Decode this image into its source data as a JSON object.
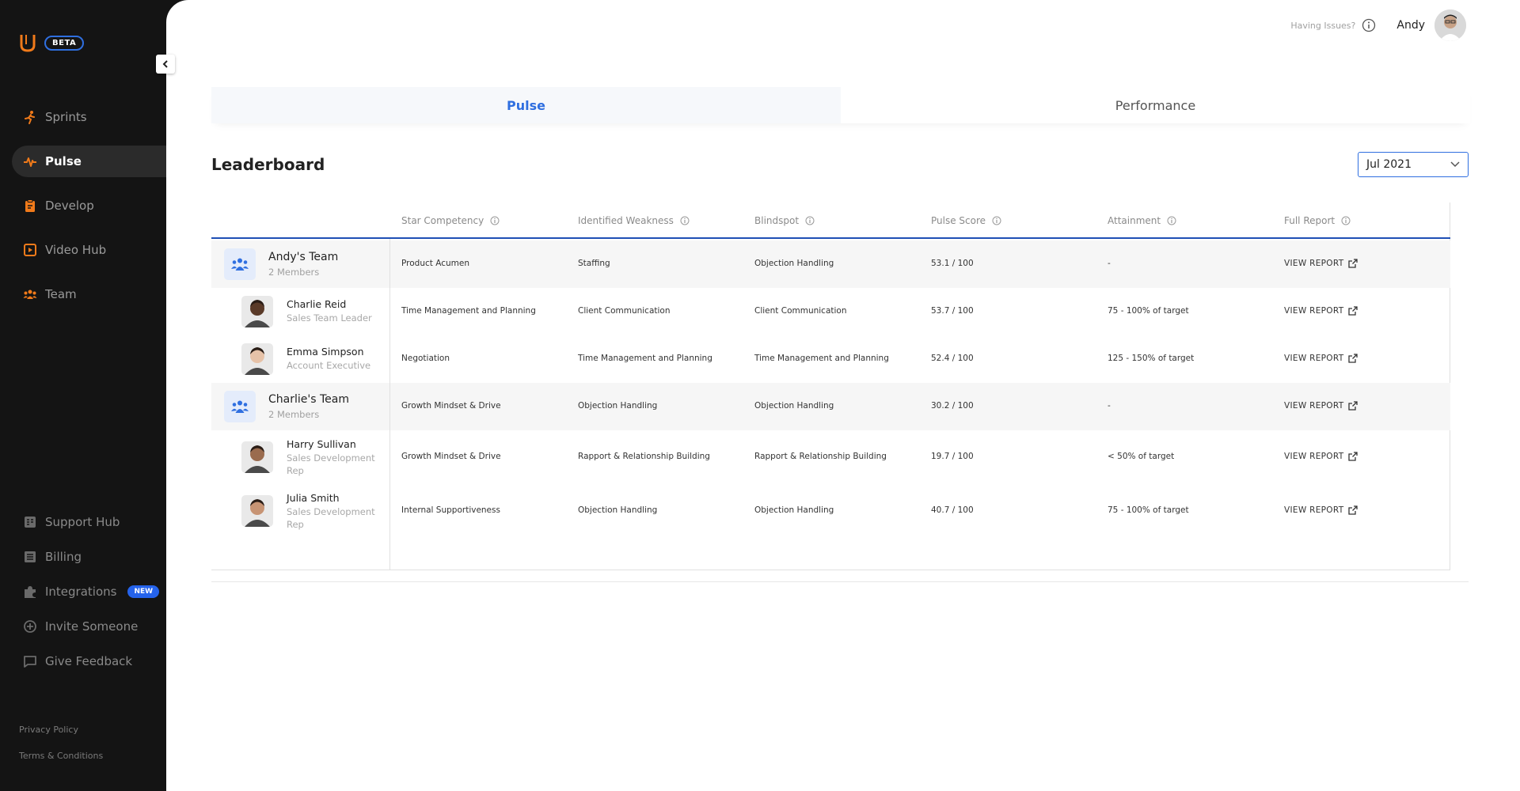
{
  "sidebar": {
    "beta": "BETA",
    "nav": [
      {
        "label": "Sprints",
        "icon": "runner-icon"
      },
      {
        "label": "Pulse",
        "icon": "pulse-icon"
      },
      {
        "label": "Develop",
        "icon": "clipboard-icon"
      },
      {
        "label": "Video Hub",
        "icon": "video-icon"
      },
      {
        "label": "Team",
        "icon": "team-icon"
      }
    ],
    "bottom": [
      {
        "label": "Support Hub",
        "icon": "support-icon"
      },
      {
        "label": "Billing",
        "icon": "billing-icon"
      },
      {
        "label": "Integrations",
        "icon": "puzzle-icon",
        "badge": "NEW"
      },
      {
        "label": "Invite Someone",
        "icon": "plus-circle-icon"
      },
      {
        "label": "Give Feedback",
        "icon": "chat-icon"
      }
    ],
    "footer": {
      "privacy": "Privacy Policy",
      "terms": "Terms & Conditions"
    }
  },
  "topbar": {
    "issues": "Having Issues?",
    "user": "Andy"
  },
  "tabs": [
    {
      "label": "Pulse",
      "active": true
    },
    {
      "label": "Performance",
      "active": false
    }
  ],
  "page_title": "Leaderboard",
  "month": "Jul 2021",
  "table": {
    "headers": [
      "Star Competency",
      "Identified Weakness",
      "Blindspot",
      "Pulse Score",
      "Attainment",
      "Full Report"
    ],
    "report_label": "VIEW REPORT",
    "rows": [
      {
        "type": "team",
        "name": "Andy's Team",
        "sub": "2 Members",
        "star": "Product Acumen",
        "weakness": "Staffing",
        "blindspot": "Objection Handling",
        "score": "53.1 / 100",
        "attainment": "-"
      },
      {
        "type": "person",
        "name": "Charlie Reid",
        "sub": "Sales Team Leader",
        "star": "Time Management and Planning",
        "weakness": "Client Communication",
        "blindspot": "Client Communication",
        "score": "53.7 / 100",
        "attainment": "75 - 100% of target"
      },
      {
        "type": "person",
        "name": "Emma Simpson",
        "sub": "Account Executive",
        "star": "Negotiation",
        "weakness": "Time Management and Planning",
        "blindspot": "Time Management and Planning",
        "score": "52.4 / 100",
        "attainment": "125 - 150% of target"
      },
      {
        "type": "team",
        "name": "Charlie's Team",
        "sub": "2 Members",
        "star": "Growth Mindset & Drive",
        "weakness": "Objection Handling",
        "blindspot": "Objection Handling",
        "score": "30.2 / 100",
        "attainment": "-"
      },
      {
        "type": "person",
        "name": "Harry Sullivan",
        "sub": "Sales Development Rep",
        "star": "Growth Mindset & Drive",
        "weakness": "Rapport & Relationship Building",
        "blindspot": "Rapport & Relationship Building",
        "score": "19.7 / 100",
        "attainment": "< 50% of target"
      },
      {
        "type": "person",
        "name": "Julia Smith",
        "sub": "Sales Development Rep",
        "star": "Internal Supportiveness",
        "weakness": "Objection Handling",
        "blindspot": "Objection Handling",
        "score": "40.7 / 100",
        "attainment": "75 - 100% of target"
      }
    ]
  },
  "colors": {
    "accent": "#2f6fe0",
    "brand_orange": "#f07a1a",
    "sidebar_bg": "#141414"
  }
}
